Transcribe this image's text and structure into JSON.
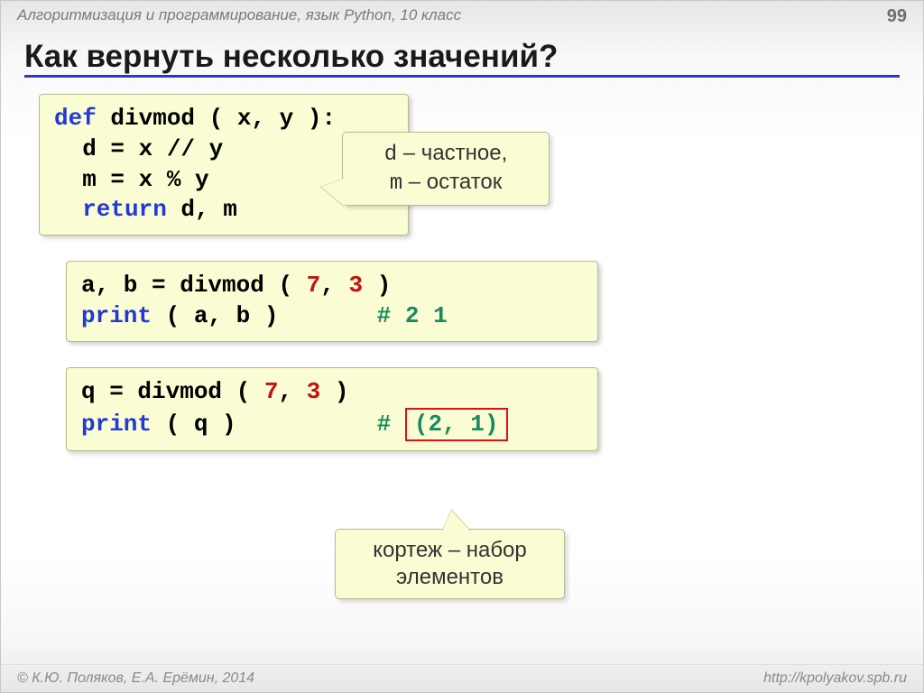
{
  "header": {
    "subject": "Алгоритмизация и программирование, язык Python, 10 класс",
    "page": "99"
  },
  "title": "Как вернуть несколько значений?",
  "code": {
    "def": {
      "kw_def": "def",
      "sig": " divmod ( x, y ):",
      "l2": "  d = x // y",
      "l3": "  m = x % y",
      "kw_return": "  return",
      "ret_tail": " d, m"
    },
    "call1": {
      "assign": "a, b = divmod",
      "args_open": " ( ",
      "arg1": "7",
      "sep": ", ",
      "arg2": "3",
      "args_close": " )",
      "print_kw": "print",
      "print_tail": " ( a, b )       ",
      "comment": "# 2 1"
    },
    "call2": {
      "assign": "q = divmod",
      "args_open": " ( ",
      "arg1": "7",
      "sep": ", ",
      "arg2": "3",
      "args_close": " )",
      "print_kw": "print",
      "print_tail": " ( q )          ",
      "hash": "# ",
      "tuple": "(2, 1)"
    }
  },
  "callouts": {
    "c1_line1a": "d",
    "c1_line1b": " – частное,",
    "c1_line2a": "m",
    "c1_line2b": " – остаток",
    "c2_line1": "кортеж – набор",
    "c2_line2": "элементов"
  },
  "footer": {
    "left": "© К.Ю. Поляков, Е.А. Ерёмин, 2014",
    "right": "http://kpolyakov.spb.ru"
  }
}
